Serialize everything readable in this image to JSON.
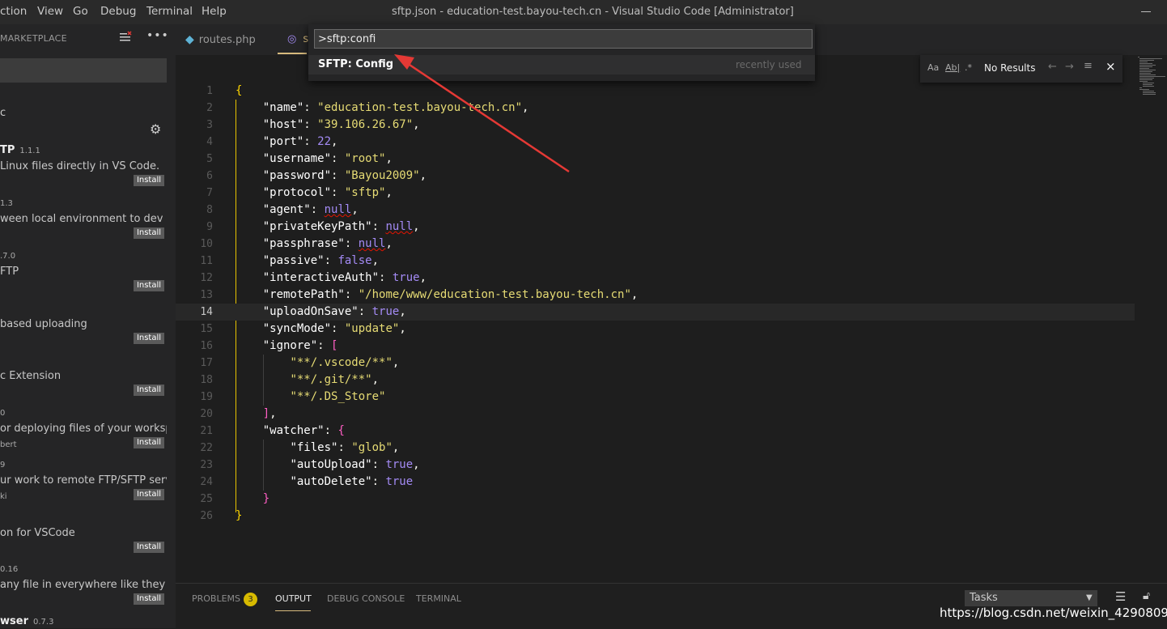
{
  "window": {
    "title": "sftp.json - education-test.bayou-tech.cn - Visual Studio Code [Administrator]",
    "menu": [
      "ction",
      "View",
      "Go",
      "Debug",
      "Terminal",
      "Help"
    ]
  },
  "sidebar": {
    "header": "MARKETPLACE",
    "filter_text": "c",
    "extensions": [
      {
        "name": "TP",
        "version": "1.1.1",
        "desc": "Linux files directly in VS Code.",
        "author": "",
        "install": "Install"
      },
      {
        "name": "",
        "version": "1.3",
        "desc": "ween local environment to dev s...",
        "author": "",
        "install": "Install"
      },
      {
        "name": "",
        "version": ".7.0",
        "desc": "FTP",
        "author": "",
        "install": "Install"
      },
      {
        "name": "",
        "version": "",
        "desc": "based uploading",
        "author": "",
        "install": "Install"
      },
      {
        "name": "",
        "version": "",
        "desc": "c Extension",
        "author": "",
        "install": "Install"
      },
      {
        "name": "",
        "version": "0",
        "desc": "or deploying files of your worksp...",
        "author": "bert",
        "install": "Install"
      },
      {
        "name": "",
        "version": "9",
        "desc": "ur work to remote FTP/SFTP serv...",
        "author": "ki",
        "install": "Install"
      },
      {
        "name": "",
        "version": "",
        "desc": "on for VSCode",
        "author": "",
        "install": "Install"
      },
      {
        "name": "",
        "version": "0.16",
        "desc": "any file in everywhere like they ...",
        "author": "",
        "install": "Install"
      },
      {
        "name": "wser",
        "version": "0.7.3",
        "desc": "",
        "author": "",
        "install": ""
      }
    ]
  },
  "tabs": [
    {
      "label": "routes.php"
    },
    {
      "label": "s"
    }
  ],
  "command_palette": {
    "input_value": ">sftp:confi",
    "item_label": "SFTP: Config",
    "item_hint": "recently used"
  },
  "find_widget": {
    "opt_case": "Aa",
    "opt_word": "Ab|",
    "opt_regex": ".*",
    "results": "No Results",
    "close": "×"
  },
  "editor": {
    "current_line": 14,
    "lines": [
      {
        "num": "1",
        "tokens": [
          [
            "o",
            "{"
          ]
        ]
      },
      {
        "num": "2",
        "tokens": [
          [
            "p",
            "    "
          ],
          [
            "k",
            "\"name\""
          ],
          [
            "p",
            ": "
          ],
          [
            "s",
            "\"education-test.bayou-tech.cn\""
          ],
          [
            "p",
            ","
          ]
        ]
      },
      {
        "num": "3",
        "tokens": [
          [
            "p",
            "    "
          ],
          [
            "k",
            "\"host\""
          ],
          [
            "p",
            ": "
          ],
          [
            "s",
            "\"39.106.26.67\""
          ],
          [
            "p",
            ","
          ]
        ]
      },
      {
        "num": "4",
        "tokens": [
          [
            "p",
            "    "
          ],
          [
            "k",
            "\"port\""
          ],
          [
            "p",
            ": "
          ],
          [
            "n",
            "22"
          ],
          [
            "p",
            ","
          ]
        ]
      },
      {
        "num": "5",
        "tokens": [
          [
            "p",
            "    "
          ],
          [
            "k",
            "\"username\""
          ],
          [
            "p",
            ": "
          ],
          [
            "s",
            "\"root\""
          ],
          [
            "p",
            ","
          ]
        ]
      },
      {
        "num": "6",
        "tokens": [
          [
            "p",
            "    "
          ],
          [
            "k",
            "\"password\""
          ],
          [
            "p",
            ": "
          ],
          [
            "s",
            "\"Bayou2009\""
          ],
          [
            "p",
            ","
          ]
        ]
      },
      {
        "num": "7",
        "tokens": [
          [
            "p",
            "    "
          ],
          [
            "k",
            "\"protocol\""
          ],
          [
            "p",
            ": "
          ],
          [
            "s",
            "\"sftp\""
          ],
          [
            "p",
            ","
          ]
        ]
      },
      {
        "num": "8",
        "tokens": [
          [
            "p",
            "    "
          ],
          [
            "k",
            "\"agent\""
          ],
          [
            "p",
            ": "
          ],
          [
            "nsq",
            "null"
          ],
          [
            "p",
            ","
          ]
        ]
      },
      {
        "num": "9",
        "tokens": [
          [
            "p",
            "    "
          ],
          [
            "k",
            "\"privateKeyPath\""
          ],
          [
            "p",
            ": "
          ],
          [
            "nsq",
            "null"
          ],
          [
            "p",
            ","
          ]
        ]
      },
      {
        "num": "10",
        "tokens": [
          [
            "p",
            "    "
          ],
          [
            "k",
            "\"passphrase\""
          ],
          [
            "p",
            ": "
          ],
          [
            "nsq",
            "null"
          ],
          [
            "p",
            ","
          ]
        ]
      },
      {
        "num": "11",
        "tokens": [
          [
            "p",
            "    "
          ],
          [
            "k",
            "\"passive\""
          ],
          [
            "p",
            ": "
          ],
          [
            "n",
            "false"
          ],
          [
            "p",
            ","
          ]
        ]
      },
      {
        "num": "12",
        "tokens": [
          [
            "p",
            "    "
          ],
          [
            "k",
            "\"interactiveAuth\""
          ],
          [
            "p",
            ": "
          ],
          [
            "n",
            "true"
          ],
          [
            "p",
            ","
          ]
        ]
      },
      {
        "num": "13",
        "tokens": [
          [
            "p",
            "    "
          ],
          [
            "k",
            "\"remotePath\""
          ],
          [
            "p",
            ": "
          ],
          [
            "s",
            "\"/home/www/education-test.bayou-tech.cn\""
          ],
          [
            "p",
            ","
          ]
        ]
      },
      {
        "num": "14",
        "tokens": [
          [
            "p",
            "    "
          ],
          [
            "k",
            "\"uploadOnSave\""
          ],
          [
            "p",
            ": "
          ],
          [
            "n",
            "true"
          ],
          [
            "p",
            ","
          ]
        ]
      },
      {
        "num": "15",
        "tokens": [
          [
            "p",
            "    "
          ],
          [
            "k",
            "\"syncMode\""
          ],
          [
            "p",
            ": "
          ],
          [
            "s",
            "\"update\""
          ],
          [
            "p",
            ","
          ]
        ]
      },
      {
        "num": "16",
        "tokens": [
          [
            "p",
            "    "
          ],
          [
            "k",
            "\"ignore\""
          ],
          [
            "p",
            ": "
          ],
          [
            "b",
            "["
          ]
        ]
      },
      {
        "num": "17",
        "tokens": [
          [
            "p",
            "        "
          ],
          [
            "s",
            "\"**/.vscode/**\""
          ],
          [
            "p",
            ","
          ]
        ]
      },
      {
        "num": "18",
        "tokens": [
          [
            "p",
            "        "
          ],
          [
            "s",
            "\"**/.git/**\""
          ],
          [
            "p",
            ","
          ]
        ]
      },
      {
        "num": "19",
        "tokens": [
          [
            "p",
            "        "
          ],
          [
            "s",
            "\"**/.DS_Store\""
          ]
        ]
      },
      {
        "num": "20",
        "tokens": [
          [
            "p",
            "    "
          ],
          [
            "b",
            "]"
          ],
          [
            "p",
            ","
          ]
        ]
      },
      {
        "num": "21",
        "tokens": [
          [
            "p",
            "    "
          ],
          [
            "k",
            "\"watcher\""
          ],
          [
            "p",
            ": "
          ],
          [
            "b",
            "{"
          ]
        ]
      },
      {
        "num": "22",
        "tokens": [
          [
            "p",
            "        "
          ],
          [
            "k",
            "\"files\""
          ],
          [
            "p",
            ": "
          ],
          [
            "s",
            "\"glob\""
          ],
          [
            "p",
            ","
          ]
        ]
      },
      {
        "num": "23",
        "tokens": [
          [
            "p",
            "        "
          ],
          [
            "k",
            "\"autoUpload\""
          ],
          [
            "p",
            ": "
          ],
          [
            "n",
            "true"
          ],
          [
            "p",
            ","
          ]
        ]
      },
      {
        "num": "24",
        "tokens": [
          [
            "p",
            "        "
          ],
          [
            "k",
            "\"autoDelete\""
          ],
          [
            "p",
            ": "
          ],
          [
            "n",
            "true"
          ]
        ]
      },
      {
        "num": "25",
        "tokens": [
          [
            "p",
            "    "
          ],
          [
            "b",
            "}"
          ]
        ]
      },
      {
        "num": "26",
        "tokens": [
          [
            "o",
            "}"
          ]
        ]
      }
    ]
  },
  "panel": {
    "tabs": [
      {
        "label": "PROBLEMS",
        "badge": "3"
      },
      {
        "label": "OUTPUT"
      },
      {
        "label": "DEBUG CONSOLE"
      },
      {
        "label": "TERMINAL"
      }
    ],
    "tasks_select": "Tasks"
  },
  "watermark": "https://blog.csdn.net/weixin_42908097",
  "colors": {
    "accent": "#d7ba7d",
    "arrow": "#e53935",
    "badge": "#d7ba00"
  }
}
